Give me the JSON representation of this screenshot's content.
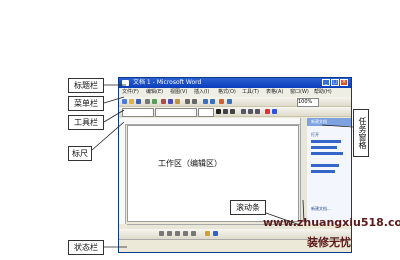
{
  "labels": {
    "title_bar": "标题栏",
    "menu_bar": "菜单栏",
    "toolbar": "工具栏",
    "ruler": "标尺",
    "work_area": "工作区（编辑区）",
    "scrollbar": "滚动条",
    "status_bar": "状态栏",
    "task_pane": "任务窗格"
  },
  "window": {
    "title": "文档 1 - Microsoft Word",
    "menu": [
      "文件(F)",
      "编辑(E)",
      "视图(V)",
      "插入(I)",
      "格式(O)",
      "工具(T)",
      "表格(A)",
      "窗口(W)",
      "帮助(H)"
    ],
    "zoom": "100%",
    "task_pane_title": "新建文档",
    "task_pane_section": "打开",
    "task_pane_new": "新建文档..."
  },
  "watermark": {
    "url": "www.zhuangxiu518.com",
    "text": "装修无忧"
  },
  "colors": {
    "title_bar": "#0a3dbb",
    "label_border": "#333333",
    "watermark": "#5a1a1a"
  }
}
